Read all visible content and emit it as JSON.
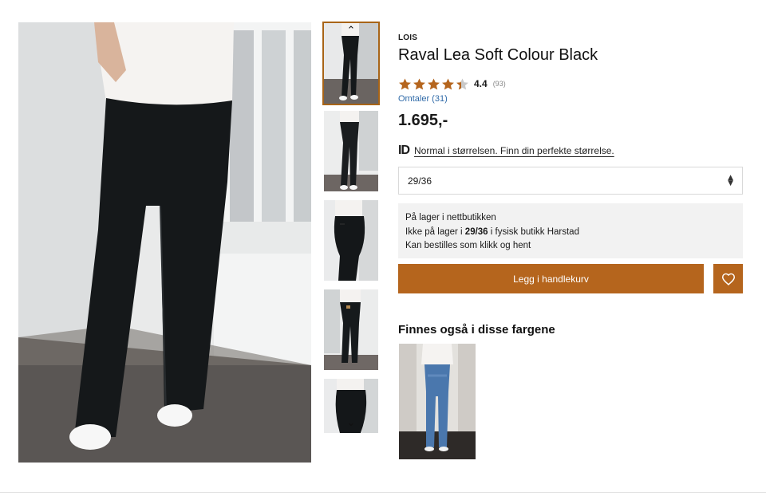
{
  "product": {
    "brand": "LOIS",
    "title": "Raval Lea Soft Colour Black",
    "rating_value": "4.4",
    "rating_stars": 4.4,
    "rating_count": "(93)",
    "reviews_link": "Omtaler (31)",
    "price": "1.695,-"
  },
  "size_hint": {
    "icon_text": "ID",
    "text": "Normal i størrelsen. Finn din perfekte størrelse."
  },
  "size_select": {
    "selected": "29/36",
    "arrows": "⌃⌄"
  },
  "stock": {
    "line1": "På lager i nettbutikken",
    "line2_prefix": "Ikke på lager i ",
    "line2_size": "29/36",
    "line2_suffix": " i fysisk butikk Harstad",
    "line3": "Kan bestilles som klikk og hent"
  },
  "buttons": {
    "add_to_cart": "Legg i handlekurv"
  },
  "variants": {
    "title": "Finnes også i disse fargene"
  },
  "thumbnails": {
    "up_arrow": "⌃",
    "down_arrow": "⌄",
    "count": 5,
    "active_index": 0
  },
  "colors": {
    "accent": "#b5651d",
    "star": "#b5651d",
    "link": "#2f6aa8",
    "stock_bg": "#f2f2f2"
  },
  "icons": {
    "wishlist": "heart-icon",
    "star": "star-icon",
    "select": "chevron-up-down-icon"
  }
}
